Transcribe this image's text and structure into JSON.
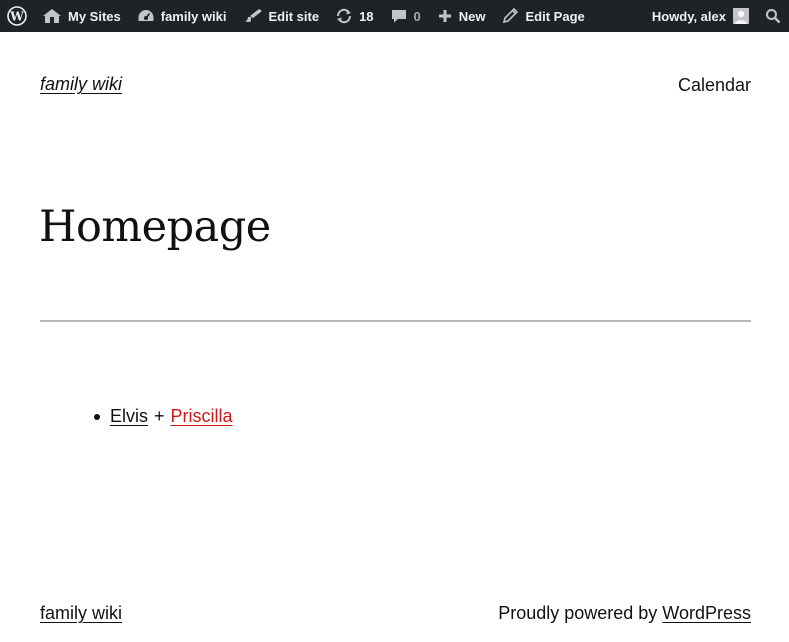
{
  "admin_bar": {
    "wp_logo_icon": "wordpress-logo-icon",
    "my_sites": {
      "label": "My Sites",
      "icon": "my-sites-icon"
    },
    "site_name": {
      "label": "family wiki",
      "icon": "dashboard-icon"
    },
    "edit_site": {
      "label": "Edit site",
      "icon": "brush-icon"
    },
    "updates": {
      "count": "18",
      "icon": "updates-icon"
    },
    "comments": {
      "count": "0",
      "icon": "comment-icon"
    },
    "new": {
      "label": "New",
      "icon": "plus-icon"
    },
    "edit_page": {
      "label": "Edit Page",
      "icon": "pencil-icon"
    },
    "account": {
      "greeting": "Howdy, alex",
      "icon": "avatar"
    },
    "search_icon": "search-icon"
  },
  "header": {
    "site_title": "family wiki",
    "nav": [
      {
        "label": "Calendar"
      }
    ]
  },
  "main": {
    "title": "Homepage",
    "list": [
      {
        "first": "Elvis",
        "separator": "+",
        "second": "Priscilla"
      }
    ]
  },
  "footer": {
    "site_title": "family wiki",
    "credit_prefix": "Proudly powered by",
    "credit_link": "WordPress"
  },
  "colors": {
    "admin_bar_bg": "#1d2327",
    "link_missing": "#cc1818",
    "text": "#111111"
  }
}
